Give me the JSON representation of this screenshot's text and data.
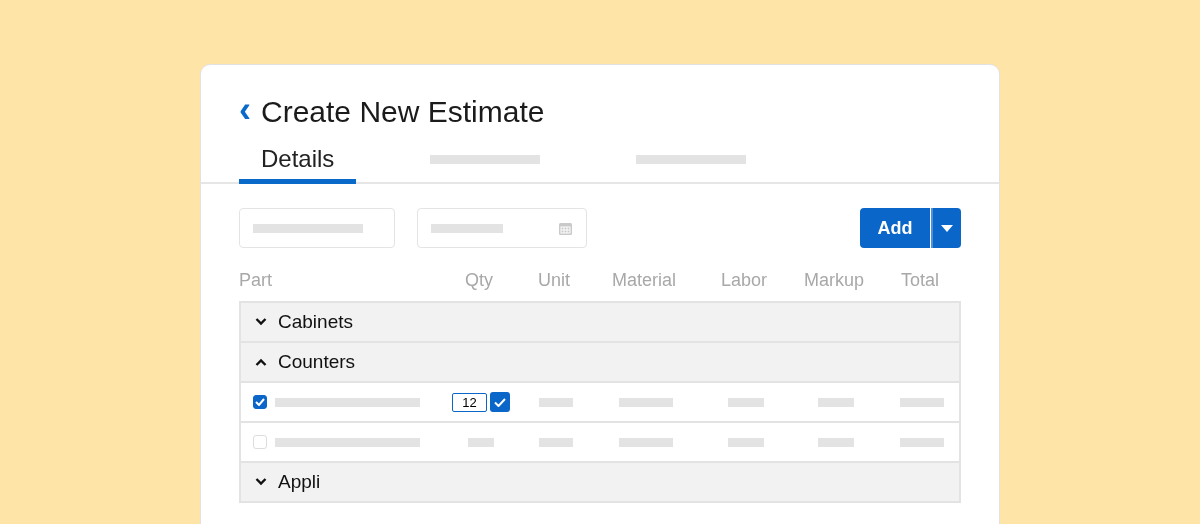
{
  "header": {
    "back_icon": "‹",
    "title": "Create New Estimate"
  },
  "tabs": [
    {
      "label": "Details",
      "selected": true
    },
    {
      "selected": false
    },
    {
      "selected": false
    }
  ],
  "filters": [
    {
      "kind": "text"
    },
    {
      "kind": "date"
    }
  ],
  "add_button": {
    "label": "Add"
  },
  "columns": [
    "Part",
    "Qty",
    "Unit",
    "Material",
    "Labor",
    "Markup",
    "Total"
  ],
  "groups": [
    {
      "label": "Cabinets",
      "expanded": false
    },
    {
      "label": "Counters",
      "expanded": true,
      "items": [
        {
          "checked": true,
          "qty": "12",
          "confirmed": true
        },
        {
          "checked": false
        }
      ]
    },
    {
      "label": "Appli",
      "expanded": false
    }
  ]
}
